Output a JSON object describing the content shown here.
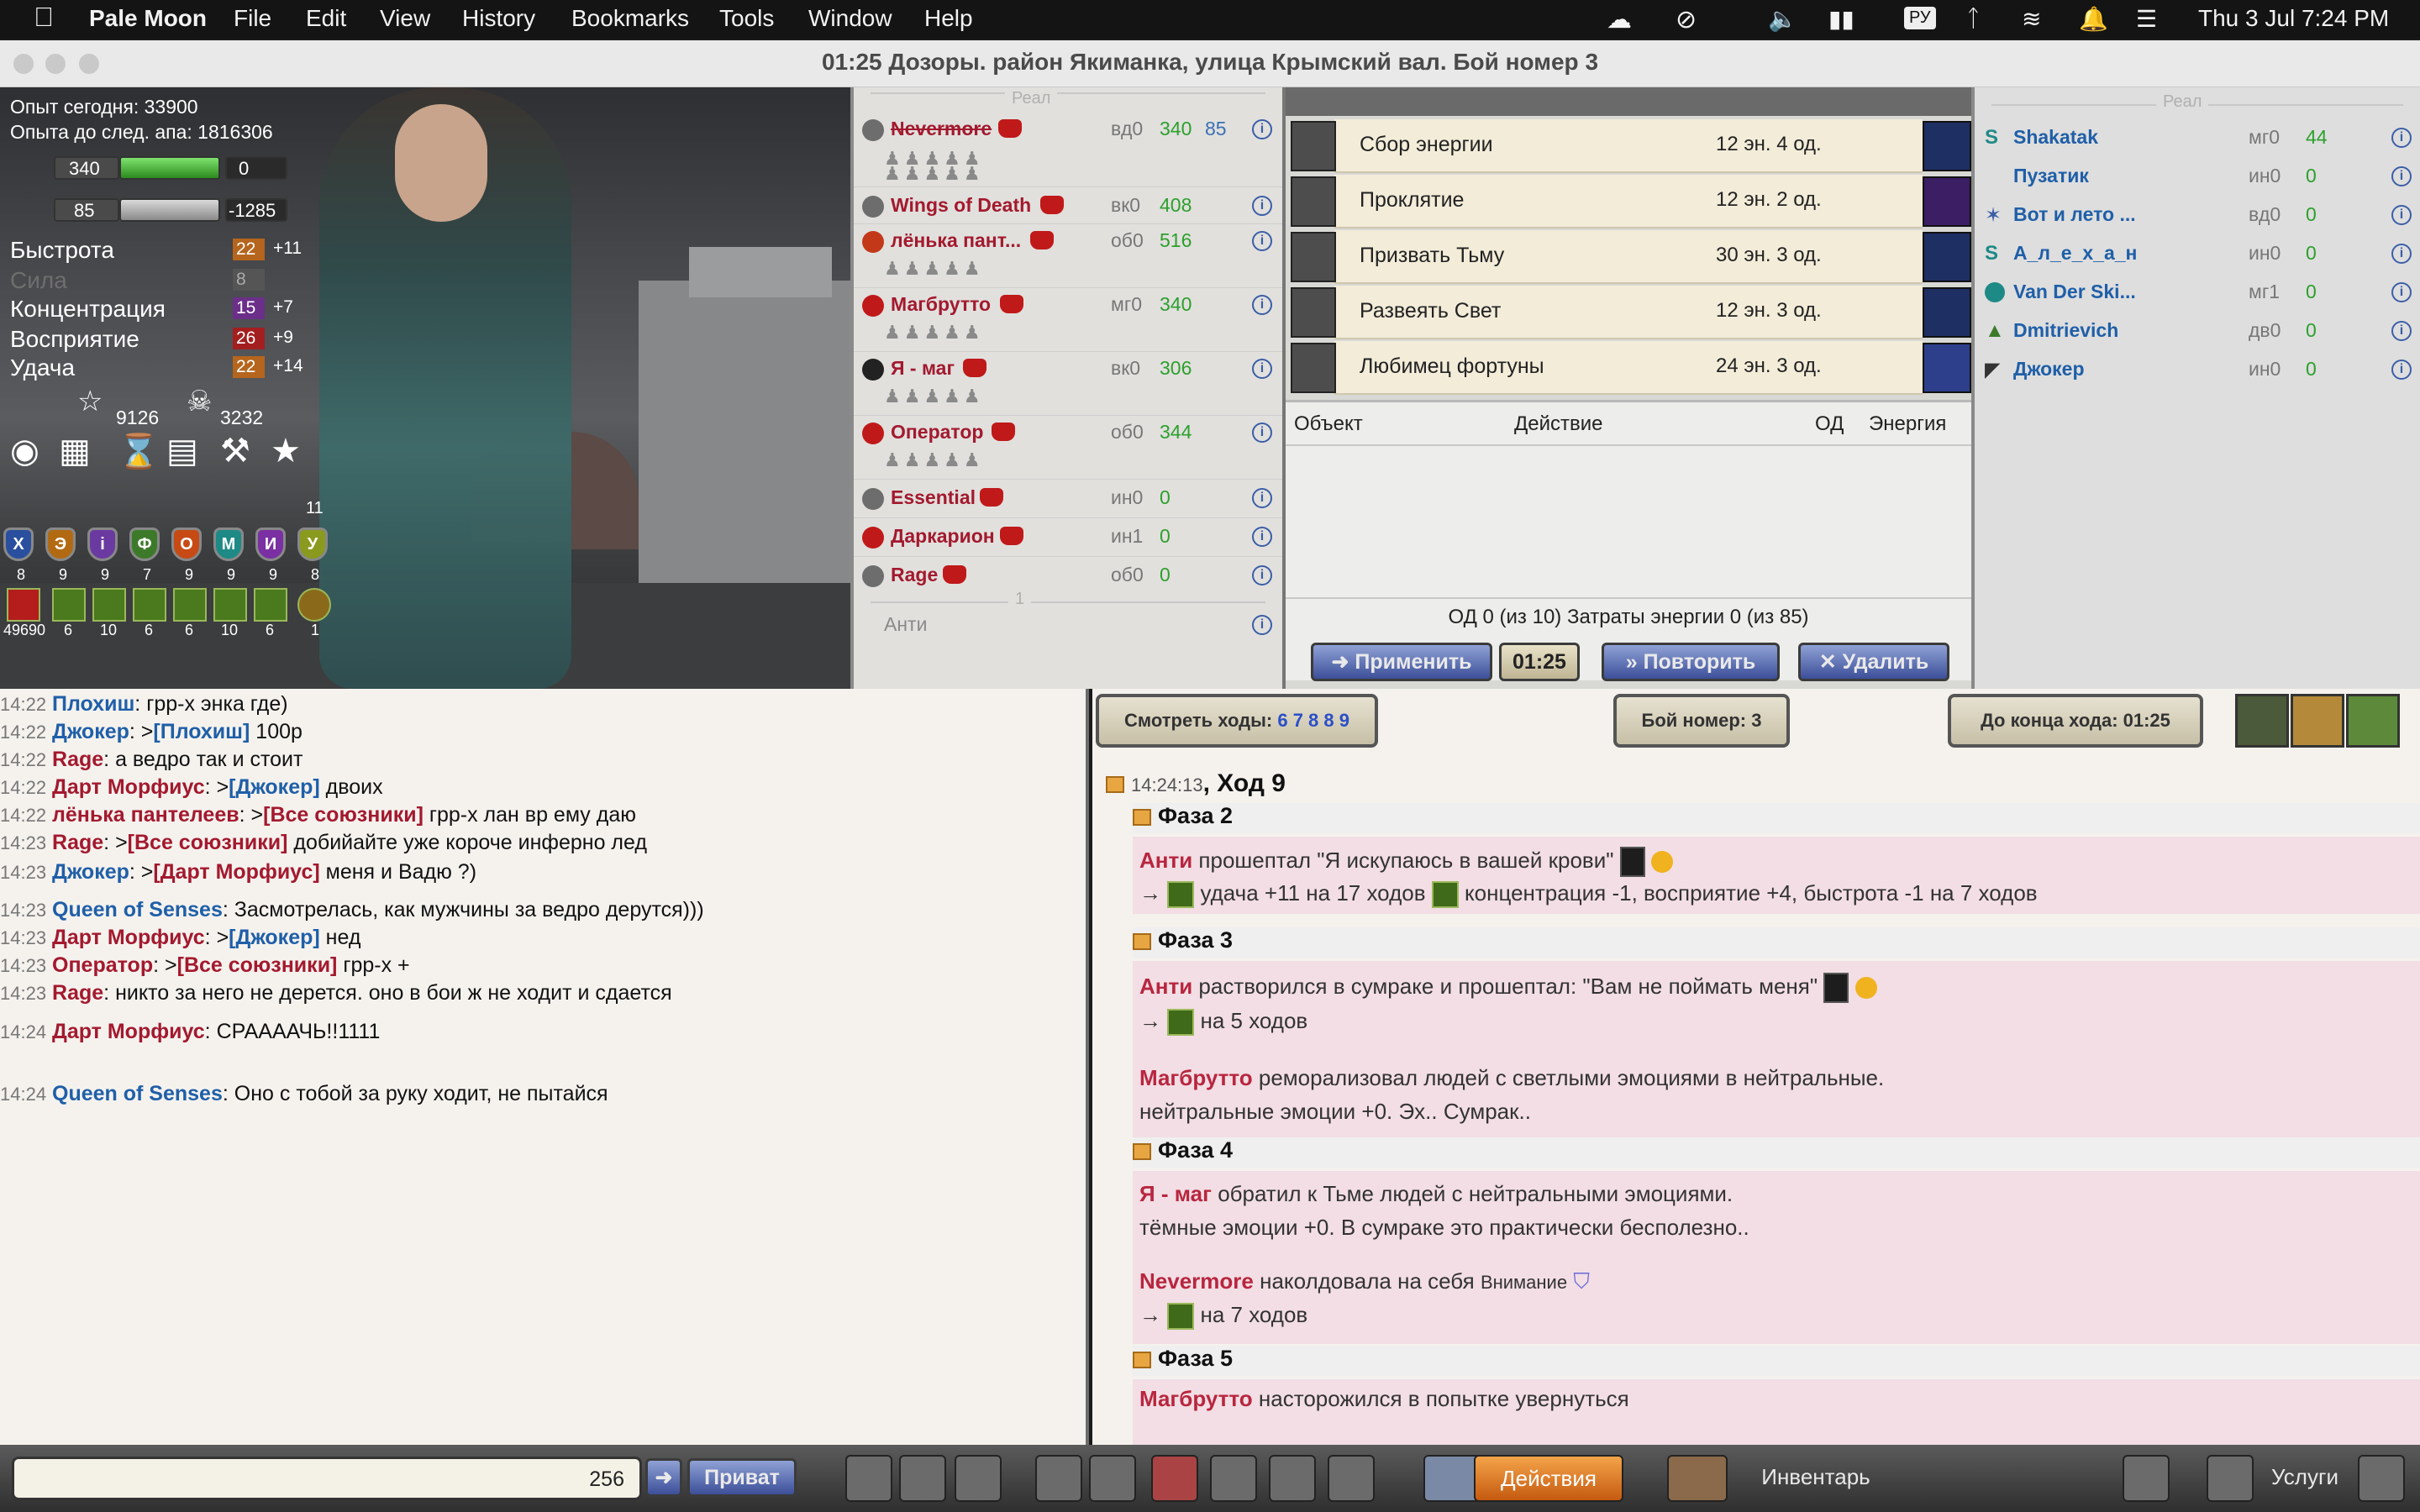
{
  "menubar": {
    "app": "Pale Moon",
    "items": [
      "File",
      "Edit",
      "View",
      "History",
      "Bookmarks",
      "Tools",
      "Window",
      "Help"
    ],
    "lang": "РУ",
    "clock": "Thu 3 Jul  7:24 PM"
  },
  "window": {
    "title": "01:25 Дозоры. район Якиманка, улица Крымский вал. Бой номер 3"
  },
  "hero": {
    "exp_today": "Опыт сегодня: 33900",
    "exp_next": "Опыта до след. апа: 1816306",
    "hp": "340",
    "hp_right": "0",
    "mp": "85",
    "mp_right": "-1285",
    "stats": [
      {
        "label": "Быстрота",
        "value": "22",
        "bonus": "+11",
        "color": "#b5651d"
      },
      {
        "label": "Сила",
        "value": "8",
        "bonus": "",
        "color": "#555"
      },
      {
        "label": "Концентрация",
        "value": "15",
        "bonus": "+7",
        "color": "#6b2f8a"
      },
      {
        "label": "Восприятие",
        "value": "26",
        "bonus": "+9",
        "color": "#a31f1f"
      },
      {
        "label": "Удача",
        "value": "22",
        "bonus": "+14",
        "color": "#b5651d"
      }
    ],
    "stars": "9126",
    "skulls": "3232",
    "rune_top": "11",
    "runes": [
      {
        "glyph": "X",
        "color": "#2a4f9e",
        "n": "8"
      },
      {
        "glyph": "Э",
        "color": "#b26a12",
        "n": "9"
      },
      {
        "glyph": "i",
        "color": "#6a3aa1",
        "n": "9"
      },
      {
        "glyph": "Ф",
        "color": "#3c7a2a",
        "n": "7"
      },
      {
        "glyph": "О",
        "color": "#c74a14",
        "n": "9"
      },
      {
        "glyph": "М",
        "color": "#1e8a86",
        "n": "9"
      },
      {
        "glyph": "И",
        "color": "#7a2fa3",
        "n": "9"
      },
      {
        "glyph": "У",
        "color": "#8a9a1e",
        "n": "8"
      }
    ],
    "items": [
      "49690",
      "6",
      "10",
      "6",
      "6",
      "10",
      "6",
      "1"
    ]
  },
  "enemies": {
    "header": "Реал",
    "rows": [
      {
        "name": "Nevermore",
        "code": "вд0",
        "hp": "340",
        "mp": "85",
        "men": true,
        "strike": true
      },
      {
        "name": "Wings of Death",
        "code": "вк0",
        "hp": "408",
        "mp": "",
        "men": false
      },
      {
        "name": "лёнька пант...",
        "code": "об0",
        "hp": "516",
        "mp": "",
        "men": true
      },
      {
        "name": "Магбрутто",
        "code": "мг0",
        "hp": "340",
        "mp": "",
        "men": true
      },
      {
        "name": "Я - маг",
        "code": "вк0",
        "hp": "306",
        "mp": "",
        "men": true
      },
      {
        "name": "Оператор",
        "code": "об0",
        "hp": "344",
        "mp": "",
        "men": true
      },
      {
        "name": "Essential",
        "code": "ин0",
        "hp": "0",
        "mp": "",
        "men": false
      },
      {
        "name": "Даркарион",
        "code": "ин1",
        "hp": "0",
        "mp": "",
        "men": false
      },
      {
        "name": "Rage",
        "code": "об0",
        "hp": "0",
        "mp": "",
        "men": false
      }
    ],
    "sep_num": "1",
    "anti": "Анти"
  },
  "spells": {
    "rows": [
      {
        "name": "Сбор энергии",
        "cost": "12 эн.  4 од."
      },
      {
        "name": "Проклятие",
        "cost": "12 эн.  2 од."
      },
      {
        "name": "Призвать Тьму",
        "cost": "30 эн.  3 од."
      },
      {
        "name": "Развеять Свет",
        "cost": "12 эн.  3 од."
      },
      {
        "name": "Любимец фортуны",
        "cost": "24 эн.  3 од."
      }
    ],
    "cols": {
      "object": "Объект",
      "action": "Действие",
      "od": "ОД",
      "energy": "Энергия"
    },
    "summary": "ОД 0 (из 10) Затраты энергии 0 (из 85)",
    "apply": "Применить",
    "timer": "01:25",
    "repeat": "Повторить",
    "delete": "Удалить"
  },
  "allies": {
    "header": "Реал",
    "rows": [
      {
        "name": "Shakatak",
        "code": "мг0",
        "hp": "44"
      },
      {
        "name": "Пузатик",
        "code": "ин0",
        "hp": "0"
      },
      {
        "name": "Вот и лето ...",
        "code": "вд0",
        "hp": "0"
      },
      {
        "name": "А_л_е_х_а_н",
        "code": "ин0",
        "hp": "0"
      },
      {
        "name": "Van Der Ski...",
        "code": "мг1",
        "hp": "0"
      },
      {
        "name": "Dmitrievich",
        "code": "дв0",
        "hp": "0"
      },
      {
        "name": "Джокер",
        "code": "ин0",
        "hp": "0"
      }
    ]
  },
  "chat": {
    "lines": [
      {
        "t": "14:22",
        "n": "Плохиш",
        "c": "b",
        "to": "",
        "m": "грр-х энка где)"
      },
      {
        "t": "14:22",
        "n": "Джокер",
        "c": "b",
        "to": "[Плохиш]",
        "toc": "b",
        "m": "100р"
      },
      {
        "t": "14:22",
        "n": "Rage",
        "c": "r",
        "to": "",
        "m": "а ведро так и стоит"
      },
      {
        "t": "14:22",
        "n": "Дарт Морфиус",
        "c": "r",
        "to": "[Джокер]",
        "toc": "b",
        "m": "двоих"
      },
      {
        "t": "14:22",
        "n": "лёнька пантелеев",
        "c": "r",
        "to": "[Все союзники]",
        "toc": "r",
        "m": "грр-х лан вр ему даю"
      },
      {
        "t": "14:23",
        "n": "Rage",
        "c": "r",
        "to": "[Все союзники]",
        "toc": "r",
        "m": "добийайте уже короче инферно лед"
      },
      {
        "t": "14:23",
        "n": "Джокер",
        "c": "b",
        "to": "[Дарт Морфиус]",
        "toc": "r",
        "m": "меня и Вадю ?)"
      },
      {
        "t": "14:23",
        "n": "Queen of Senses",
        "c": "b",
        "to": "",
        "m": "Засмотрелась, как мужчины за ведро дерутся)))"
      },
      {
        "t": "14:23",
        "n": "Дарт Морфиус",
        "c": "r",
        "to": "[Джокер]",
        "toc": "b",
        "m": "нед"
      },
      {
        "t": "14:23",
        "n": "Оператор",
        "c": "r",
        "to": "[Все союзники]",
        "toc": "r",
        "m": "грр-х +"
      },
      {
        "t": "14:23",
        "n": "Rage",
        "c": "r",
        "to": "",
        "m": "никто за него не дерется. оно в бои ж не ходит и сдается"
      },
      {
        "t": "14:24",
        "n": "Дарт Морфиус",
        "c": "r",
        "to": "",
        "m": "СРААААЧЬ!!1111"
      },
      {
        "t": "14:24",
        "n": "Queen of Senses",
        "c": "b",
        "to": "",
        "m": "Оно с тобой за руку ходит, не пытайся"
      }
    ],
    "input_count": "256",
    "private": "Приват"
  },
  "log": {
    "moves_label": "Смотреть ходы:",
    "moves": "6 7 8 8 9",
    "battle": "Бой номер: 3",
    "turn_end": "До конца хода: 01:25",
    "turn_time": "14:24:13",
    "turn": ", Ход 9",
    "phase2": "Фаза 2",
    "p2_l1_name": "Анти",
    "p2_l1_text": " прошептал \"Я искупаюсь в вашей крови\"",
    "p2_l2a": "удача +11 на 17 ходов",
    "p2_l2b": "концентрация -1, восприятие +4, быстрота -1 на 7 ходов",
    "phase3": "Фаза 3",
    "p3_l1_name": "Анти",
    "p3_l1_text": " растворился в сумраке и прошептал: \"Вам не поймать меня\"",
    "p3_l2": "на 5 ходов",
    "p3_l3_name": "Магбрутто",
    "p3_l3_text": " реморализовал людей с светлыми эмоциями в нейтральные.",
    "p3_l4": "нейтральные эмоции +0. Эх.. Сумрак..",
    "phase4": "Фаза 4",
    "p4_l1_name": "Я - маг",
    "p4_l1_text": " обратил к Тьме людей с нейтральными эмоциями.",
    "p4_l2": "тёмные эмоции +0. В сумраке это практически бесполезно..",
    "p4_l3_name": "Nevermore",
    "p4_l3_text": " наколдовала на себя ",
    "p4_l3_small": "Внимание",
    "p4_l4": "на 7 ходов",
    "phase5": "Фаза 5",
    "p5_l1_name": "Магбрутто",
    "p5_l1_text": " насторожился в попытке увернуться",
    "arrow": "→"
  },
  "bottom": {
    "actions": "Действия",
    "inventory": "Инвентарь",
    "services": "Услуги"
  }
}
